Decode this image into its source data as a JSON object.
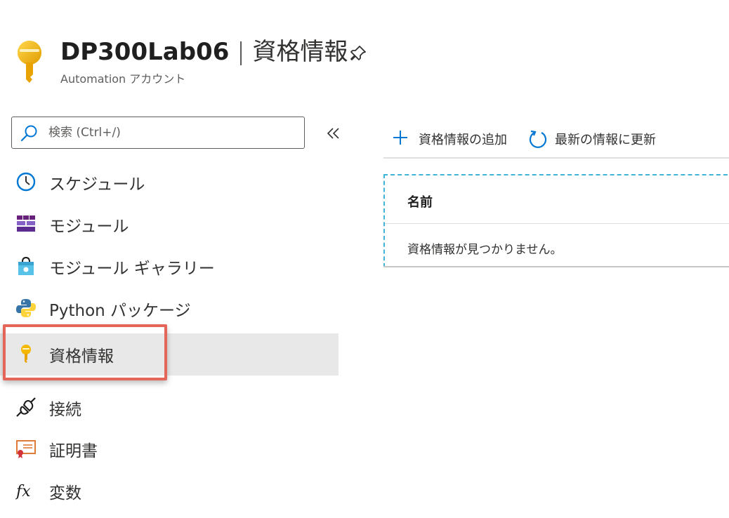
{
  "header": {
    "resource_name": "DP300Lab06",
    "separator": "|",
    "section": "資格情報",
    "subtitle": "Automation アカウント",
    "pin_icon": "pin-icon"
  },
  "search": {
    "placeholder": "検索 (Ctrl+/)"
  },
  "sidebar": {
    "items": [
      {
        "label": "スケジュール",
        "icon": "clock-icon"
      },
      {
        "label": "モジュール",
        "icon": "modules-icon"
      },
      {
        "label": "モジュール ギャラリー",
        "icon": "shopping-bag-icon"
      },
      {
        "label": "Python パッケージ",
        "icon": "python-icon"
      },
      {
        "label": "資格情報",
        "icon": "key-icon",
        "selected": true
      },
      {
        "label": "接続",
        "icon": "plug-icon"
      },
      {
        "label": "証明書",
        "icon": "certificate-icon"
      },
      {
        "label": "変数",
        "icon": "fx-icon"
      }
    ]
  },
  "toolbar": {
    "add_label": "資格情報の追加",
    "refresh_label": "最新の情報に更新"
  },
  "grid": {
    "columns": [
      "名前"
    ],
    "empty_message": "資格情報が見つかりません。"
  },
  "colors": {
    "accent": "#0078d4",
    "highlight_border": "#e4655a",
    "selected_bg": "#e8e8e8",
    "key_gold": "#f5b800",
    "dashed_border": "#40b4d8"
  }
}
